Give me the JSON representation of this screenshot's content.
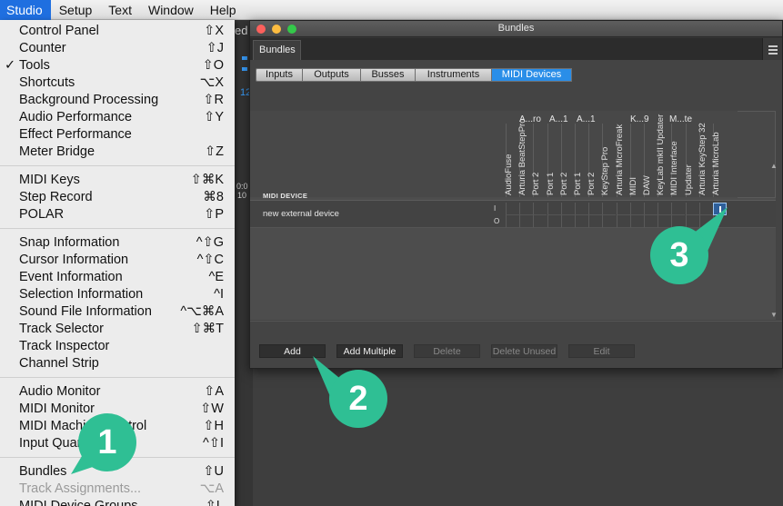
{
  "menubar": {
    "items": [
      "Studio",
      "Setup",
      "Text",
      "Window",
      "Help"
    ],
    "active": "Studio"
  },
  "background": {
    "frag1": "ed C",
    "frag2": "12",
    "frag3": "0:0",
    "frag4": "10"
  },
  "studio_menu": {
    "groups": [
      [
        {
          "label": "Control Panel",
          "shortcut": "⇧X"
        },
        {
          "label": "Counter",
          "shortcut": "⇧J"
        },
        {
          "label": "Tools",
          "shortcut": "⇧O",
          "checked": true
        },
        {
          "label": "Shortcuts",
          "shortcut": "⌥X"
        },
        {
          "label": "Background Processing",
          "shortcut": "⇧R"
        },
        {
          "label": "Audio Performance",
          "shortcut": "⇧Y"
        },
        {
          "label": "Effect Performance",
          "shortcut": ""
        },
        {
          "label": "Meter Bridge",
          "shortcut": "⇧Z"
        }
      ],
      [
        {
          "label": "MIDI Keys",
          "shortcut": "⇧⌘K"
        },
        {
          "label": "Step Record",
          "shortcut": "⌘8"
        },
        {
          "label": "POLAR",
          "shortcut": "⇧P"
        }
      ],
      [
        {
          "label": "Snap Information",
          "shortcut": "^⇧G"
        },
        {
          "label": "Cursor Information",
          "shortcut": "^⇧C"
        },
        {
          "label": "Event Information",
          "shortcut": "^E"
        },
        {
          "label": "Selection Information",
          "shortcut": "^I"
        },
        {
          "label": "Sound File Information",
          "shortcut": "^⌥⌘A"
        },
        {
          "label": "Track Selector",
          "shortcut": "⇧⌘T"
        },
        {
          "label": "Track Inspector",
          "shortcut": ""
        },
        {
          "label": "Channel Strip",
          "shortcut": ""
        }
      ],
      [
        {
          "label": "Audio Monitor",
          "shortcut": "⇧A"
        },
        {
          "label": "MIDI Monitor",
          "shortcut": "⇧W"
        },
        {
          "label": "MIDI Machine Control",
          "shortcut": "⇧H"
        },
        {
          "label": "Input Quantize",
          "shortcut": "^⇧I"
        }
      ],
      [
        {
          "label": "Bundles",
          "shortcut": "⇧U"
        },
        {
          "label": "Track Assignments...",
          "shortcut": "⌥A",
          "disabled": true
        },
        {
          "label": "MIDI Device Groups",
          "shortcut": "⇧L"
        }
      ]
    ]
  },
  "bundles_window": {
    "title": "Bundles",
    "tab_label": "Bundles",
    "segments": [
      "Inputs",
      "Outputs",
      "Busses",
      "Instruments",
      "MIDI Devices"
    ],
    "active_segment": "MIDI Devices",
    "group_headers": [
      "A...ro",
      "A...1",
      "A...1",
      "K...9",
      "M...te"
    ],
    "columns": [
      "AudioFuse",
      "Arturia BeatStepPro",
      "Port 2",
      "Port 1",
      "Port 2",
      "Port 1",
      "Port 2",
      "KeyStep Pro",
      "Arturia MicroFreak",
      "MIDI",
      "DAW",
      "KeyLab mkII Updater",
      "MIDI Interface",
      "Updater",
      "Arturia KeyStep 32",
      "Arturia MicroLab"
    ],
    "header_label": "MIDI DEVICE",
    "device": {
      "name": "new external device",
      "io_in": "I",
      "io_out": "O",
      "selected_column": "Arturia MicroLab"
    },
    "buttons": [
      {
        "label": "Add",
        "enabled": true
      },
      {
        "label": "Add Multiple",
        "enabled": true
      },
      {
        "label": "Delete",
        "enabled": false
      },
      {
        "label": "Delete Unused",
        "enabled": false
      },
      {
        "label": "Edit",
        "enabled": false
      }
    ]
  },
  "callouts": [
    "1",
    "2",
    "3"
  ],
  "colors": {
    "accent": "#2a8ee8",
    "callout": "#2fbf94",
    "menu_highlight": "#1f6fe0"
  }
}
